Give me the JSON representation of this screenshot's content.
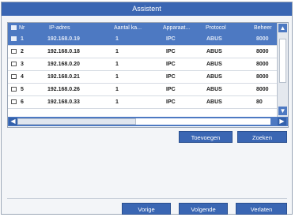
{
  "dialog": {
    "title": "Assistent"
  },
  "table": {
    "headers": [
      "Nr",
      "IP-adres",
      "Aantal ka...",
      "Apparaat...",
      "Protocol",
      "Beheer"
    ],
    "rows": [
      {
        "nr": "1",
        "ip": "192.168.0.19",
        "count": "1",
        "type": "IPC",
        "protocol": "ABUS",
        "port": "8000",
        "selected": true
      },
      {
        "nr": "2",
        "ip": "192.168.0.18",
        "count": "1",
        "type": "IPC",
        "protocol": "ABUS",
        "port": "8000",
        "selected": false
      },
      {
        "nr": "3",
        "ip": "192.168.0.20",
        "count": "1",
        "type": "IPC",
        "protocol": "ABUS",
        "port": "8000",
        "selected": false
      },
      {
        "nr": "4",
        "ip": "192.168.0.21",
        "count": "1",
        "type": "IPC",
        "protocol": "ABUS",
        "port": "8000",
        "selected": false
      },
      {
        "nr": "5",
        "ip": "192.168.0.26",
        "count": "1",
        "type": "IPC",
        "protocol": "ABUS",
        "port": "8000",
        "selected": false
      },
      {
        "nr": "6",
        "ip": "192.168.0.33",
        "count": "1",
        "type": "IPC",
        "protocol": "ABUS",
        "port": "80",
        "selected": false
      }
    ]
  },
  "actions": {
    "add": "Toevoegen",
    "search": "Zoeken"
  },
  "footer": {
    "prev": "Vorige",
    "next": "Volgende",
    "exit": "Verlaten"
  },
  "colors": {
    "accent": "#3a66b3",
    "header": "#4d79c2"
  }
}
